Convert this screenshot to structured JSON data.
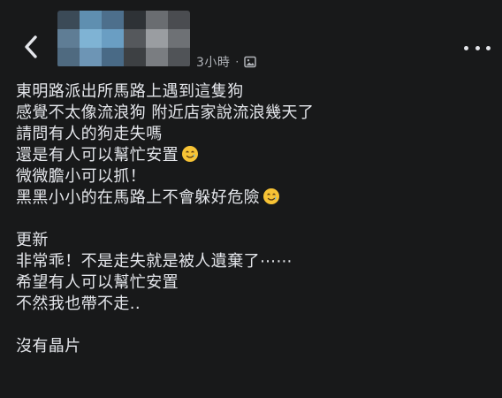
{
  "header": {
    "meta": {
      "time": "3小時",
      "separator": "·"
    }
  },
  "post": {
    "lines": [
      "東明路派出所馬路上遇到這隻狗",
      "感覺不太像流浪狗 附近店家說流浪幾天了",
      "請問有人的狗走失嗎",
      "還是有人可以幫忙安置",
      "微微膽小可以抓！",
      "黑黑小小的在馬路上不會躲好危險",
      "更新",
      "非常乖！不是走失就是被人遺棄了⋯⋯",
      "希望有人可以幫忙安置",
      "不然我也帶不走..",
      "沒有晶片"
    ]
  },
  "icons": {
    "back": "chevron-left-icon",
    "audience": "image-icon",
    "emoji": "smiling-face-with-tear-emoji",
    "more": "more-horizontal-icon"
  },
  "colors": {
    "background": "#18191a",
    "text": "#e4e6eb",
    "secondary_text": "#b0b3b8",
    "emoji_face": "#f7c335"
  }
}
